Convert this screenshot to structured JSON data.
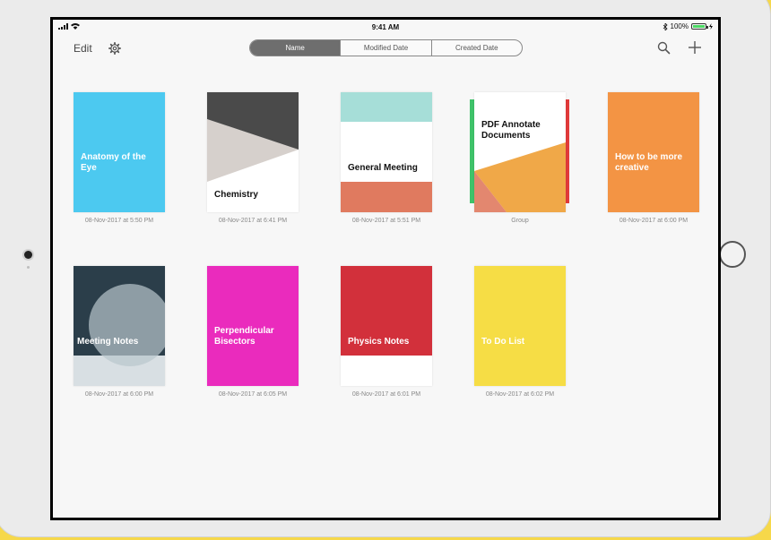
{
  "status_bar": {
    "time": "9:41 AM",
    "battery": "100%"
  },
  "toolbar": {
    "edit_label": "Edit",
    "sort_tabs": [
      {
        "label": "Name",
        "selected": true
      },
      {
        "label": "Modified Date",
        "selected": false
      },
      {
        "label": "Created Date",
        "selected": false
      }
    ]
  },
  "documents": [
    {
      "title": "Anatomy of the Eye",
      "date": "08-Nov-2017 at 5:50 PM",
      "color": "#4cc9f0"
    },
    {
      "title": "Chemistry",
      "date": "08-Nov-2017 at 6:41 PM",
      "color": "#4a4a4a"
    },
    {
      "title": "General Meeting",
      "date": "08-Nov-2017 at 5:51 PM",
      "color": "#e07a5f"
    },
    {
      "title": "PDF Annotate Documents",
      "date": "Group",
      "color": "#f0a848"
    },
    {
      "title": "How to be more creative",
      "date": "08-Nov-2017 at 6:00 PM",
      "color": "#f39444"
    },
    {
      "title": "Meeting Notes",
      "date": "08-Nov-2017 at 6:00 PM",
      "color": "#2b3e4a"
    },
    {
      "title": "Perpendicular Bisectors",
      "date": "08-Nov-2017 at 6:05 PM",
      "color": "#ea2bbd"
    },
    {
      "title": "Physics Notes",
      "date": "08-Nov-2017 at 6:01 PM",
      "color": "#d2303b"
    },
    {
      "title": "To Do List",
      "date": "08-Nov-2017 at 6:02 PM",
      "color": "#f6dd45"
    }
  ]
}
